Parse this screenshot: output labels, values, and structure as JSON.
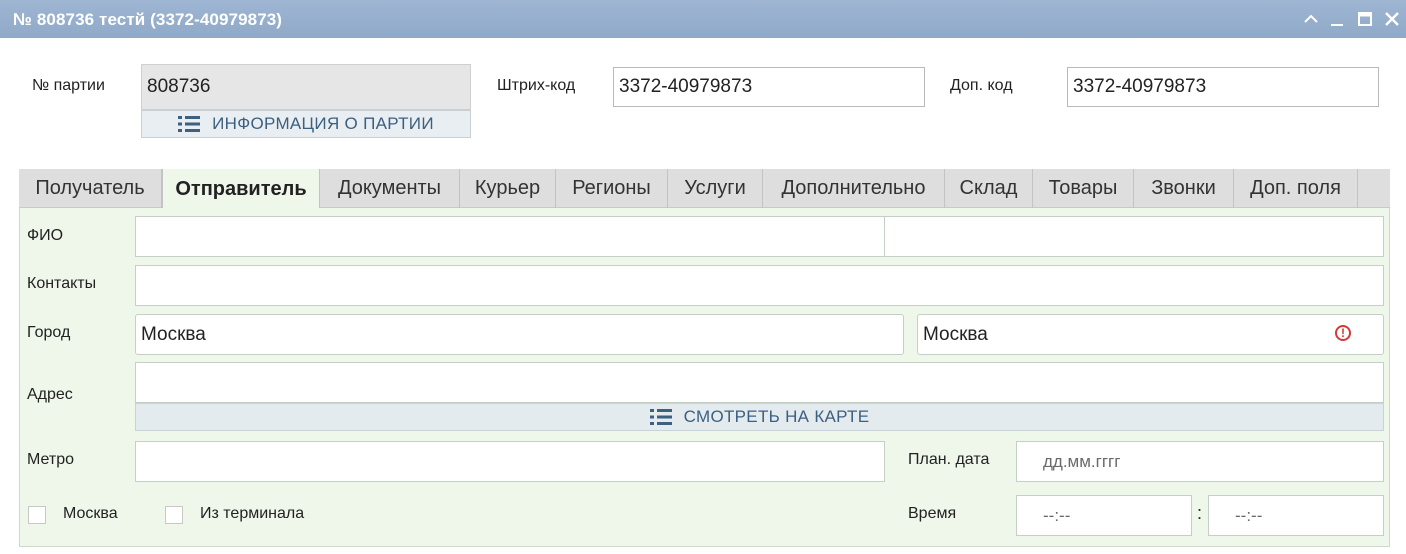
{
  "window": {
    "title": "№ 808736 тестй (3372-40979873)"
  },
  "header": {
    "batch_label": "№ партии",
    "batch_value": "808736",
    "batch_info_button": "ИНФОРМАЦИЯ О ПАРТИИ",
    "barcode_label": "Штрих-код",
    "barcode_value": "3372-40979873",
    "extra_code_label": "Доп. код",
    "extra_code_value": "3372-40979873"
  },
  "tabs": [
    {
      "label": "Получатель"
    },
    {
      "label": "Отправитель"
    },
    {
      "label": "Документы"
    },
    {
      "label": "Курьер"
    },
    {
      "label": "Регионы"
    },
    {
      "label": "Услуги"
    },
    {
      "label": "Дополнительно"
    },
    {
      "label": "Склад"
    },
    {
      "label": "Товары"
    },
    {
      "label": "Звонки"
    },
    {
      "label": "Доп. поля"
    }
  ],
  "active_tab": "Отправитель",
  "form": {
    "fio_label": "ФИО",
    "fio_value_1": "",
    "fio_value_2": "",
    "contacts_label": "Контакты",
    "contacts_value": "",
    "city_label": "Город",
    "city_value": "Москва",
    "city_value_2": "Москва",
    "address_label": "Адрес",
    "address_value": "",
    "map_button": "СМОТРЕТЬ НА КАРТЕ",
    "metro_label": "Метро",
    "metro_value": "",
    "plan_date_label": "План. дата",
    "plan_date_placeholder": "дд.мм.гггг",
    "moscow_checkbox_label": "Москва",
    "moscow_checked": false,
    "terminal_checkbox_label": "Из терминала",
    "terminal_checked": false,
    "time_label": "Время",
    "time_from_placeholder": "--:--",
    "time_separator": ":",
    "time_to_placeholder": "--:--"
  },
  "colors": {
    "titlebar": "#9eb6d2",
    "panel_bg": "#eef7ea",
    "link": "#3d5f80",
    "error": "#d23a3a"
  },
  "icons": {
    "window_controls": [
      "collapse-icon",
      "minimize-icon",
      "maximize-icon",
      "close-icon"
    ],
    "list": "list-icon",
    "error": "error-icon"
  }
}
